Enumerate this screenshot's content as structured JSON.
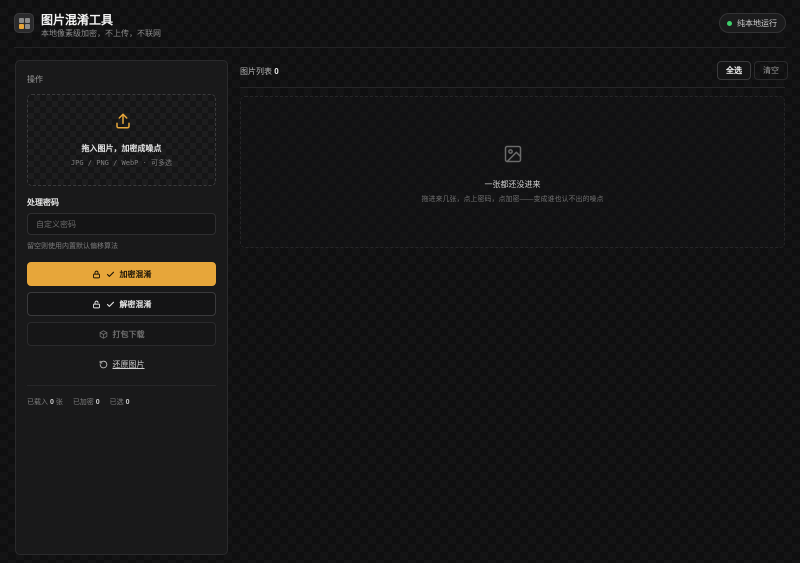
{
  "header": {
    "title": "图片混淆工具",
    "subtitle": "本地像素级加密，不上传，不联网",
    "status_badge": "纯本地运行",
    "status_color": "#3ecf6b"
  },
  "sidebar": {
    "section_label": "操作",
    "dropzone": {
      "title": "拖入图片，加密成噪点",
      "formats": "JPG / PNG / WebP · 可多选",
      "icon": "upload-icon"
    },
    "password": {
      "label": "处理密码",
      "placeholder": "自定义密码",
      "value": "",
      "hint": "留空则使用内置默认偏移算法"
    },
    "buttons": {
      "encrypt": "加密混淆",
      "decrypt": "解密混淆",
      "pack": "打包下载",
      "restore": "还原图片"
    },
    "stats": {
      "loaded_label": "已载入",
      "loaded_value": "0",
      "loaded_unit": "张",
      "encrypted_label": "已加密",
      "encrypted_value": "0",
      "selected_label": "已选",
      "selected_value": "0"
    }
  },
  "main": {
    "list_title": "图片列表",
    "list_count": "0",
    "select_all": "全选",
    "clear": "清空",
    "empty": {
      "title": "一张都还没进来",
      "subtitle": "拖进来几张，点上密码，点加密——变成谁也认不出的噪点",
      "icon": "image-icon"
    }
  },
  "colors": {
    "accent": "#e7a63a",
    "background": "#0f0f10",
    "panel": "#19191a"
  }
}
